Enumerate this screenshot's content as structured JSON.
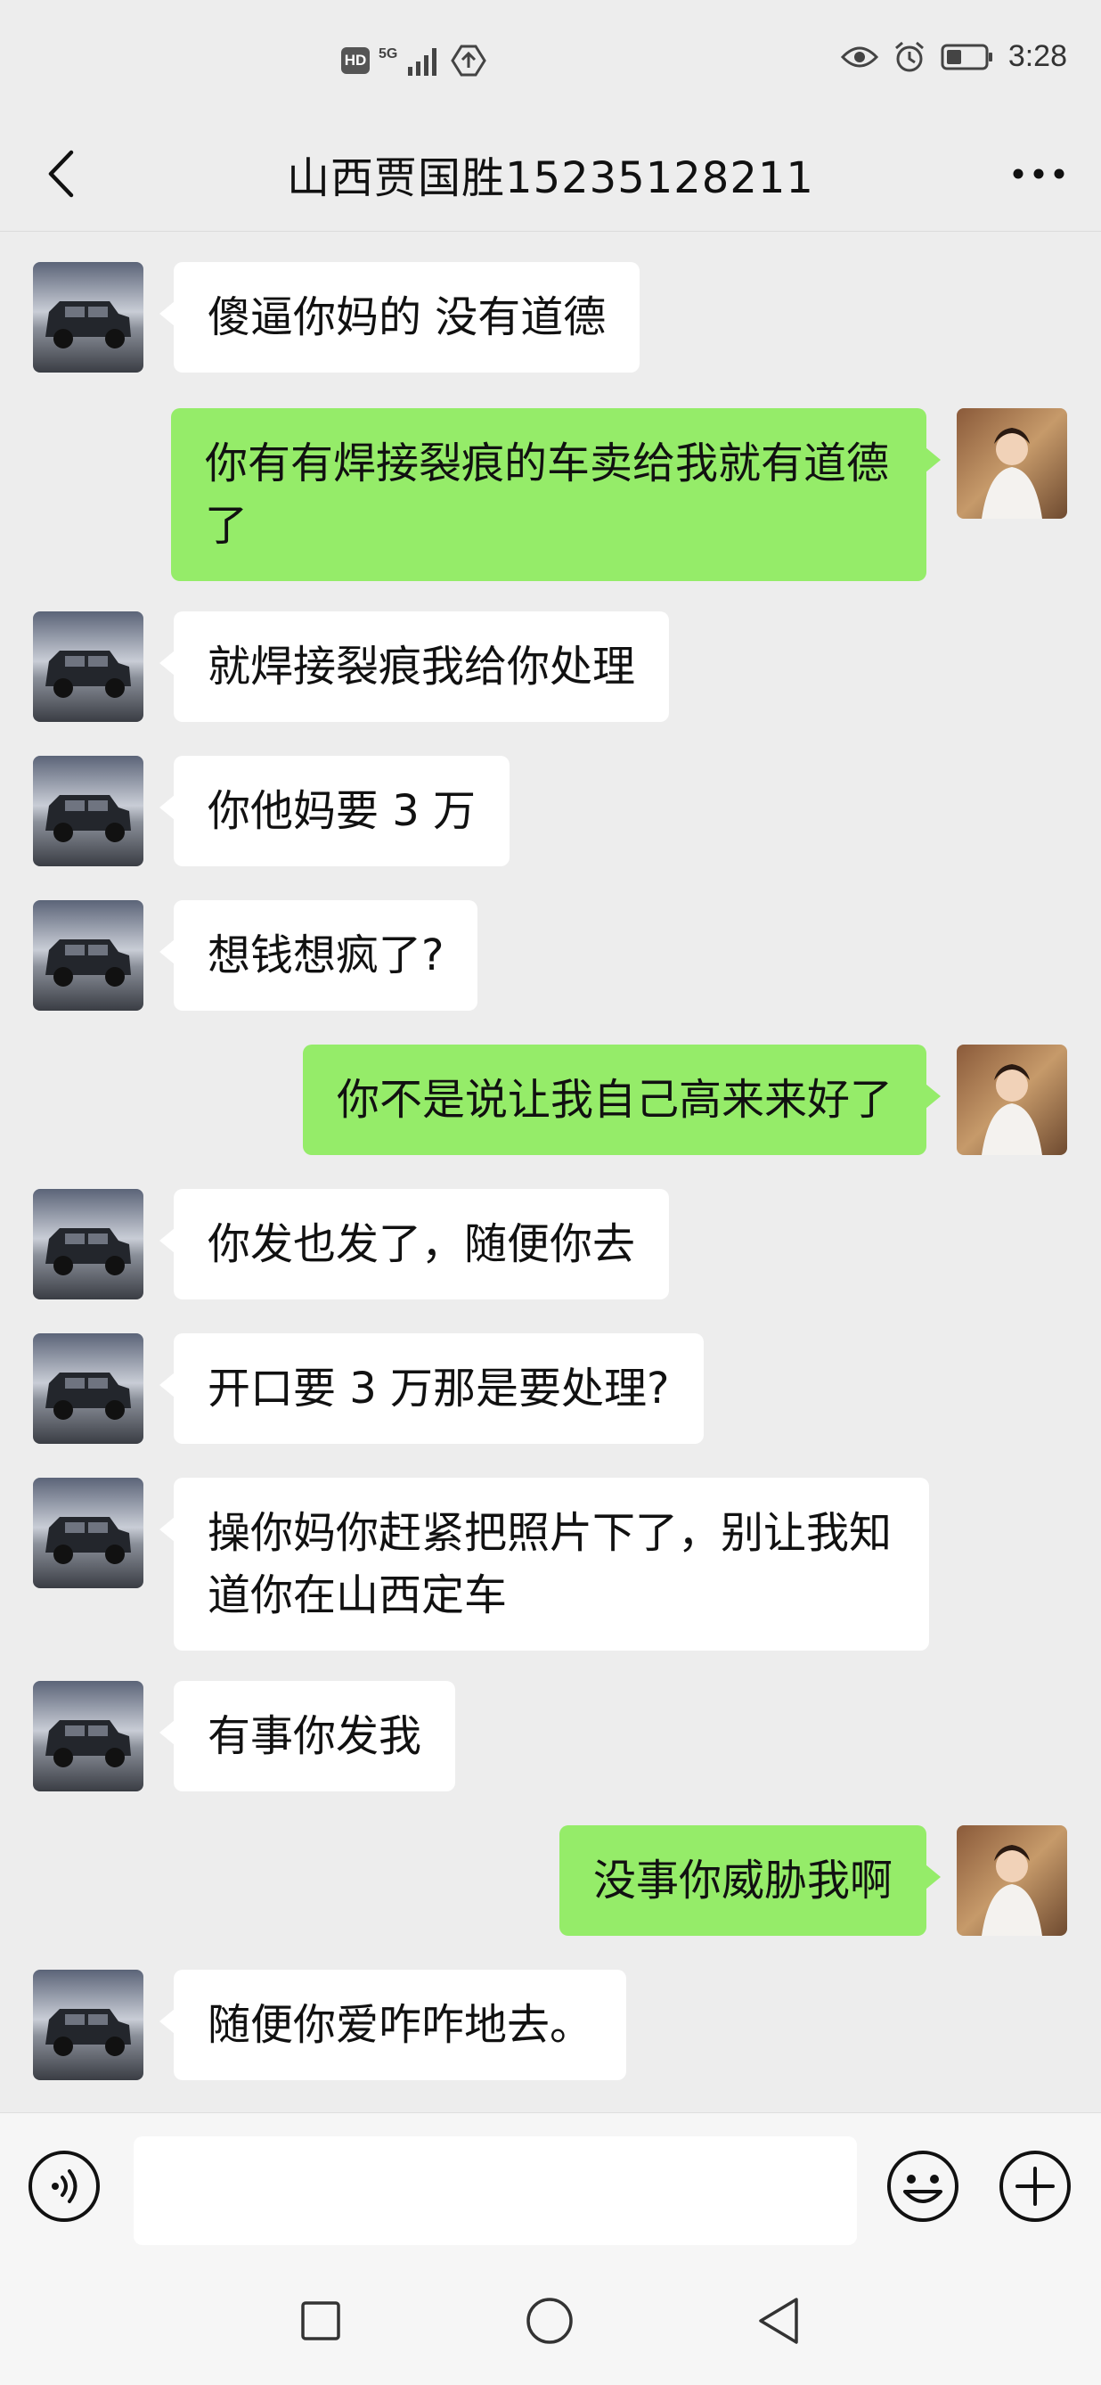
{
  "status_bar": {
    "hd": "HD",
    "network": "5G",
    "time": "3:28"
  },
  "header": {
    "title": "山西贾国胜15235128211"
  },
  "messages": [
    {
      "side": "in",
      "text": "傻逼你妈的 没有道德"
    },
    {
      "side": "out",
      "text": "你有有焊接裂痕的车卖给我就有道德了"
    },
    {
      "side": "in",
      "text": "就焊接裂痕我给你处理"
    },
    {
      "side": "in",
      "text": "你他妈要 3 万"
    },
    {
      "side": "in",
      "text": "想钱想疯了?"
    },
    {
      "side": "out",
      "text": "你不是说让我自己高来来好了"
    },
    {
      "side": "in",
      "text": "你发也发了，随便你去"
    },
    {
      "side": "in",
      "text": "开口要 3 万那是要处理?"
    },
    {
      "side": "in",
      "text": "操你妈你赶紧把照片下了，别让我知道你在山西定车"
    },
    {
      "side": "in",
      "text": "有事你发我"
    },
    {
      "side": "out",
      "text": "没事你威胁我啊"
    },
    {
      "side": "in",
      "text": "随便你爱咋咋地去。"
    }
  ],
  "input": {
    "value": "",
    "placeholder": ""
  },
  "icons": {
    "back": "chevron-left-icon",
    "more": "more-dots-icon",
    "voice": "voice-icon",
    "emoji": "emoji-icon",
    "plus": "plus-icon"
  },
  "colors": {
    "outgoing_bubble": "#95ec69",
    "incoming_bubble": "#ffffff",
    "background": "#ededed"
  }
}
